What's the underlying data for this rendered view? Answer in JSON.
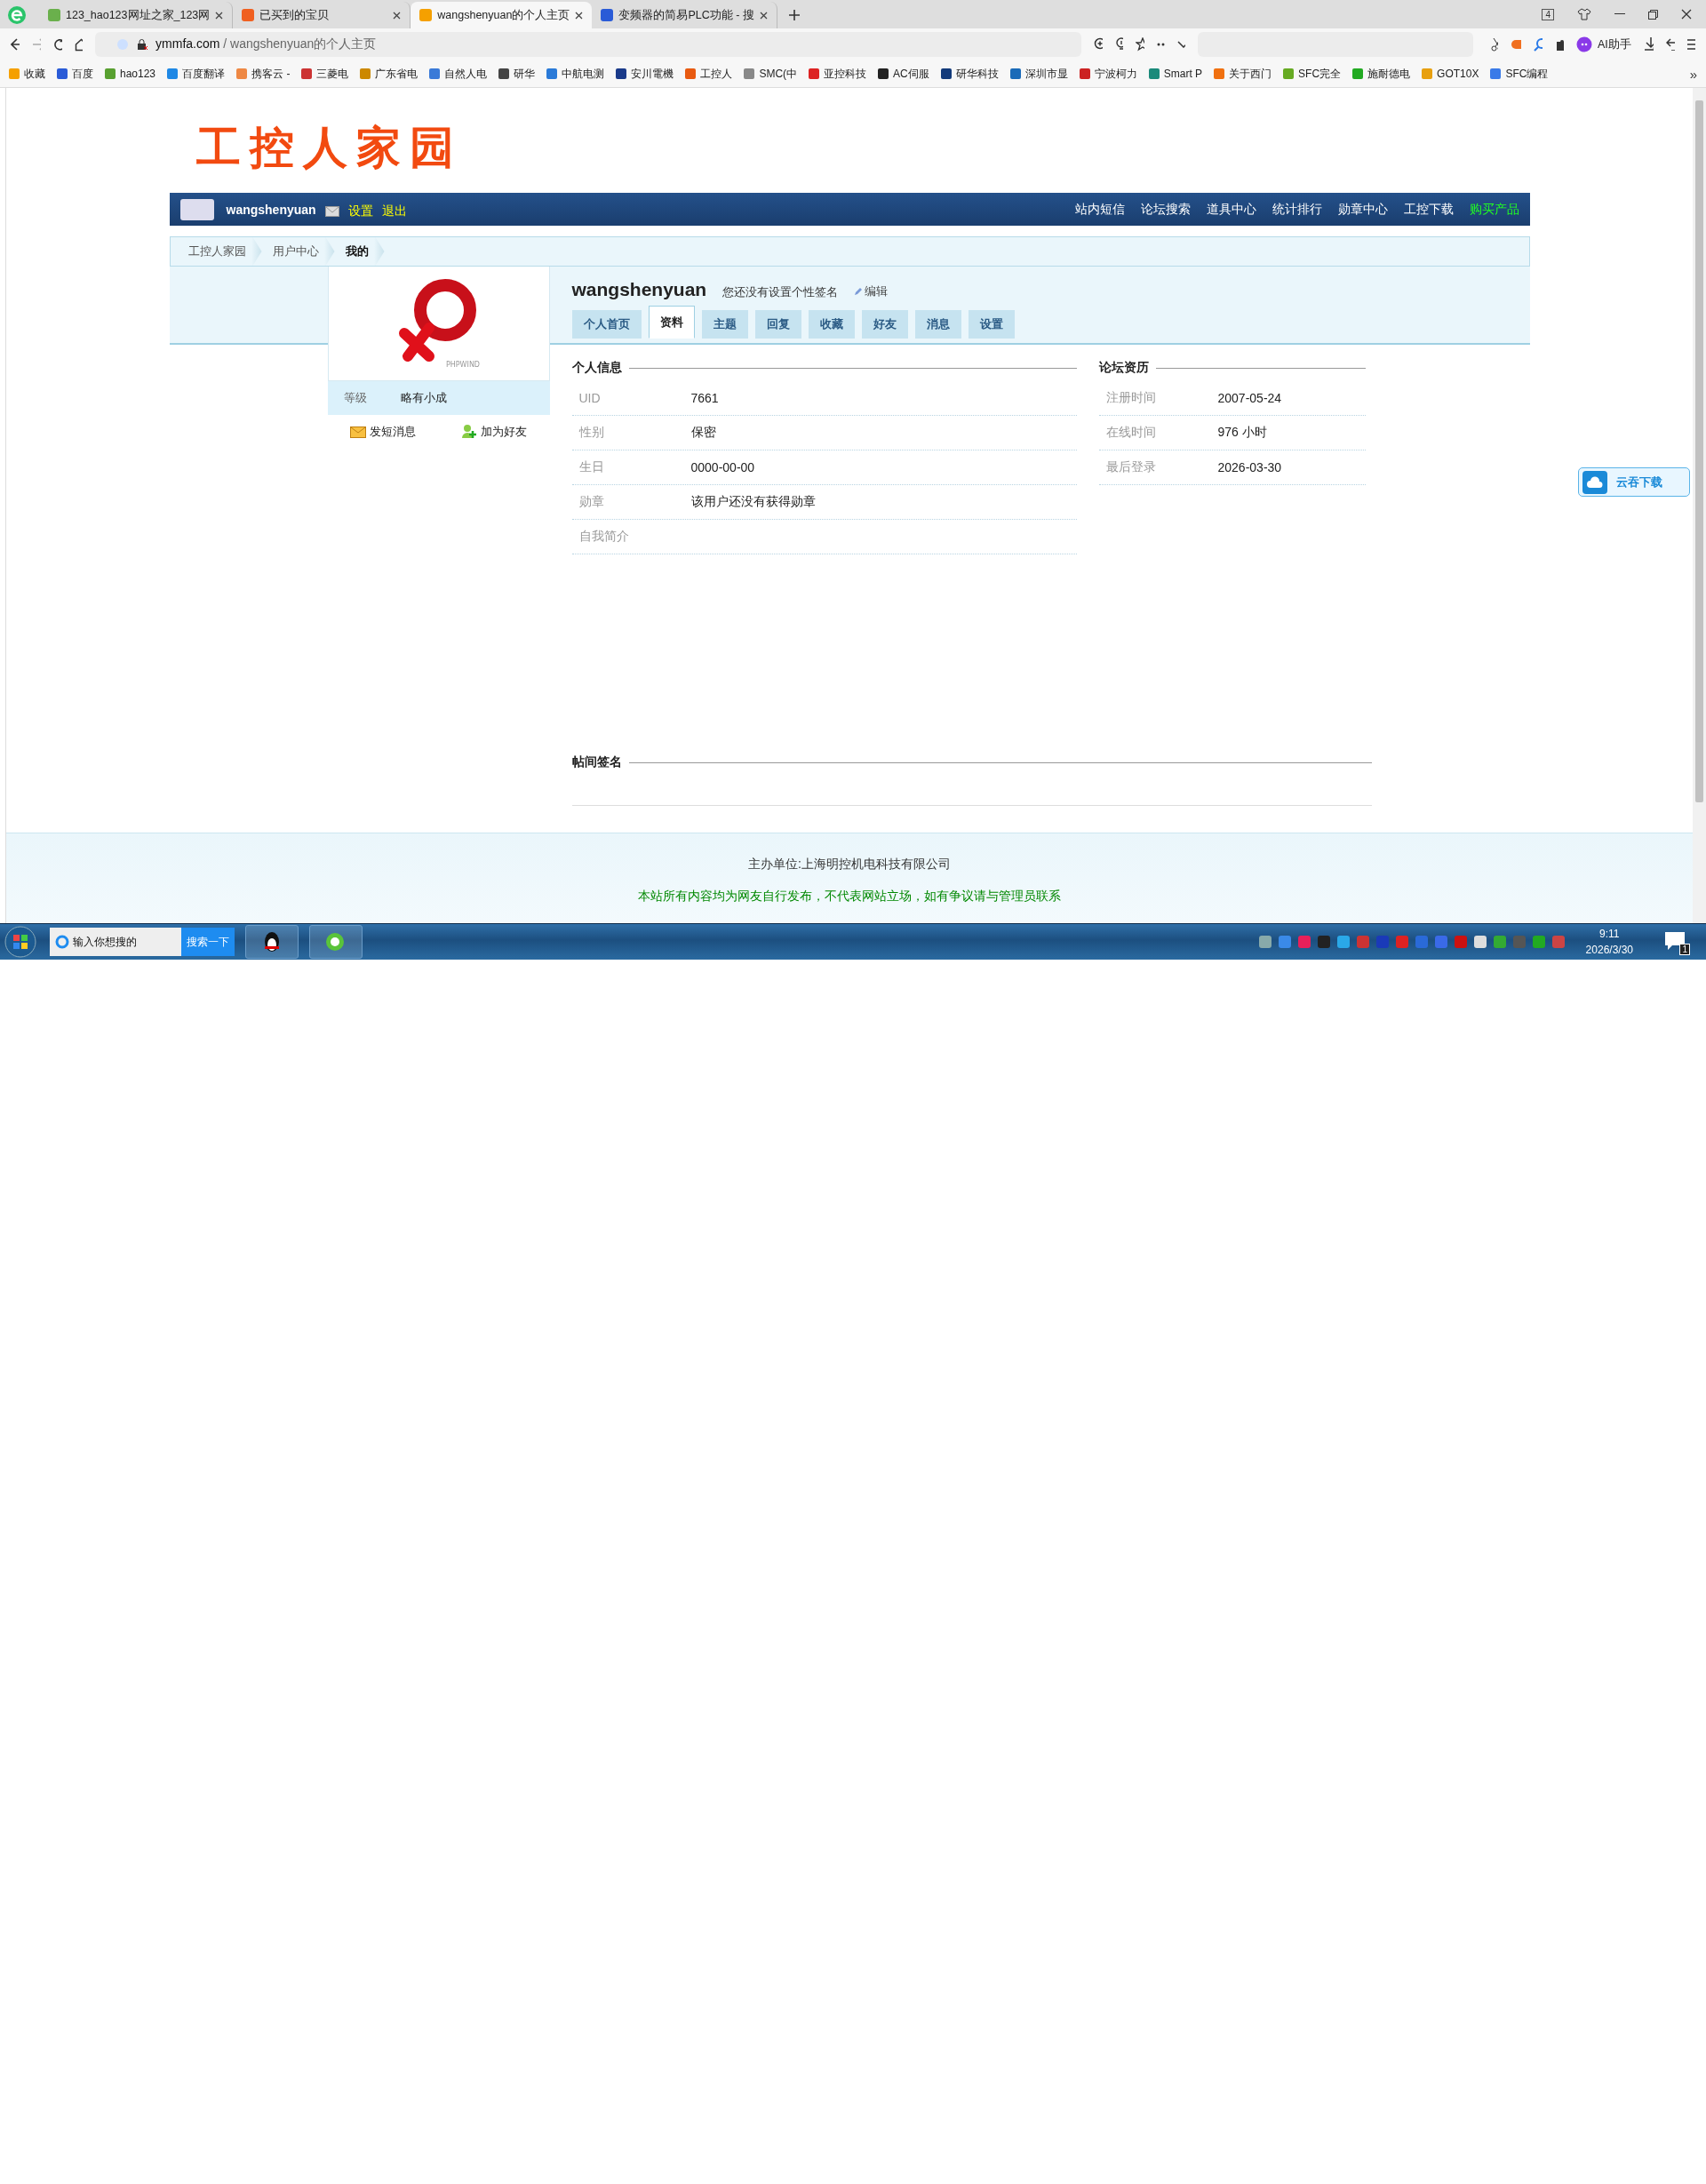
{
  "browser": {
    "tabs": [
      {
        "title": "123_hao123网址之家_123网",
        "selected": false
      },
      {
        "title": "已买到的宝贝",
        "selected": false
      },
      {
        "title": "wangshenyuan的个人主页",
        "selected": true
      },
      {
        "title": "变频器的简易PLC功能 - 搜",
        "selected": false
      }
    ],
    "window_count": "4",
    "address": {
      "domain": "ymmfa.com",
      "path": " / wangshenyuan的个人主页"
    },
    "assistant": "AI助手",
    "bookmarks": [
      "收藏",
      "百度",
      "hao123",
      "百度翻译",
      "携客云 -",
      "三菱电",
      "广东省电",
      "自然人电",
      "研华",
      "中航电测",
      "安川電機",
      "工控人",
      "SMC(中",
      "亚控科技",
      "AC伺服",
      "研华科技",
      "深圳市显",
      "宁波柯力",
      "Smart P",
      "关于西门",
      "SFC完全",
      "施耐德电",
      "GOT10X",
      "SFC编程"
    ],
    "more": "»"
  },
  "site": {
    "logo": "工控人家园",
    "user_bar": {
      "username": "wangshenyuan",
      "links": [
        "设置",
        "退出"
      ],
      "nav": [
        {
          "label": "站内短信",
          "highlight": false
        },
        {
          "label": "论坛搜索",
          "highlight": false
        },
        {
          "label": "道具中心",
          "highlight": false
        },
        {
          "label": "统计排行",
          "highlight": false
        },
        {
          "label": "勋章中心",
          "highlight": false
        },
        {
          "label": "工控下载",
          "highlight": false
        },
        {
          "label": "购买产品",
          "highlight": true
        }
      ]
    },
    "breadcrumb": [
      {
        "label": "工控人家园",
        "selected": false
      },
      {
        "label": "用户中心",
        "selected": false
      },
      {
        "label": "我的",
        "selected": true
      }
    ],
    "profile": {
      "avatar_caption": "PHPWIND",
      "level_label": "等级",
      "level_value": "略有小成",
      "actions": [
        {
          "label": "发短消息",
          "kind": "message"
        },
        {
          "label": "加为好友",
          "kind": "friend"
        }
      ],
      "name": "wangshenyuan",
      "signature": "您还没有设置个性签名",
      "edit": "编辑",
      "tabs": [
        {
          "label": "个人首页",
          "selected": false
        },
        {
          "label": "资料",
          "selected": true
        },
        {
          "label": "主题",
          "selected": false
        },
        {
          "label": "回复",
          "selected": false
        },
        {
          "label": "收藏",
          "selected": false
        },
        {
          "label": "好友",
          "selected": false
        },
        {
          "label": "消息",
          "selected": false
        },
        {
          "label": "设置",
          "selected": false
        }
      ]
    },
    "personal_info": {
      "title": "个人信息",
      "rows": [
        {
          "label": "UID",
          "value": "7661"
        },
        {
          "label": "性别",
          "value": "保密"
        },
        {
          "label": "生日",
          "value": "0000-00-00"
        },
        {
          "label": "勋章",
          "value": "该用户还没有获得勋章"
        },
        {
          "label": "自我简介"
        }
      ]
    },
    "forum_history": {
      "title": "论坛资历",
      "rows": [
        {
          "label": "注册时间",
          "value": "2007-05-24"
        },
        {
          "label": "在线时间",
          "value": "976 小时"
        },
        {
          "label": "最后登录",
          "value": "2026-03-30"
        }
      ]
    },
    "signature_section": {
      "title": "帖间签名"
    },
    "footer": [
      {
        "text": "主办单位:上海明控机电科技有限公司",
        "kind": "plain"
      },
      {
        "text": "本站所有内容均为网友自行发布，不代表网站立场，如有争议请与管理员联系",
        "kind": "notice"
      }
    ],
    "float_button": "云吞下载"
  },
  "taskbar": {
    "search": {
      "placeholder": "输入你想搜的"
    },
    "search_button": "搜索一下",
    "time": "9:11",
    "date": "2026/3/30",
    "notifications": "1"
  }
}
